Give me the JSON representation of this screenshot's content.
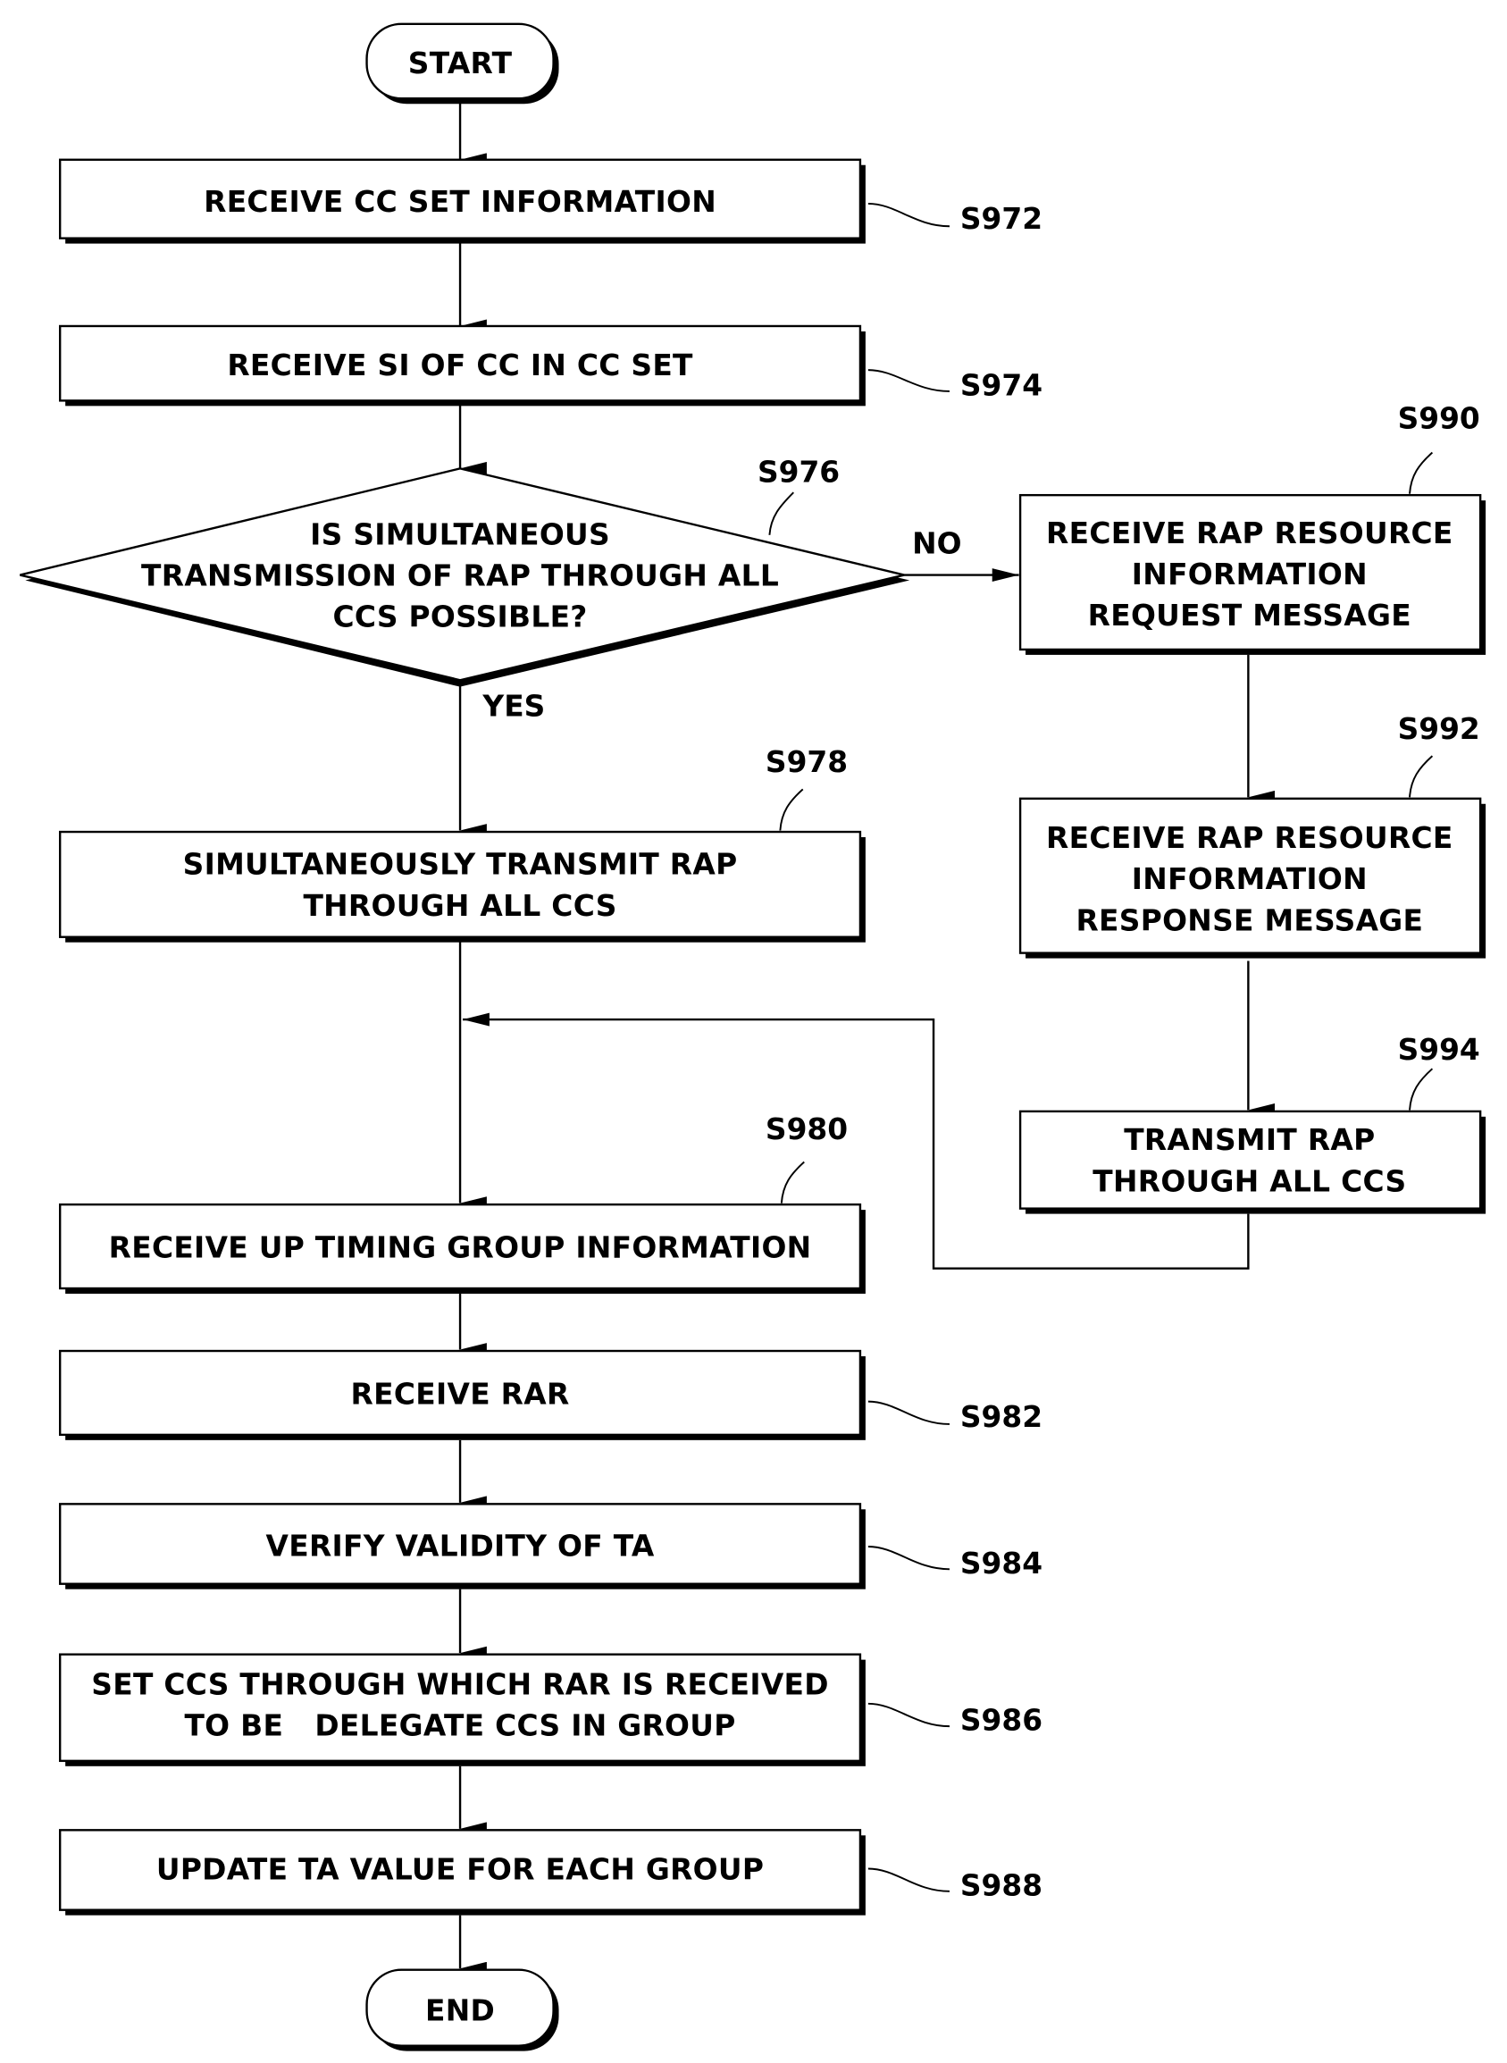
{
  "diagram": {
    "type": "flowchart",
    "nodes": {
      "start": {
        "id": "start",
        "kind": "terminal",
        "text": [
          "START"
        ]
      },
      "s972": {
        "id": "S972",
        "kind": "process",
        "text": [
          "RECEIVE CC SET INFORMATION"
        ],
        "label": "S972"
      },
      "s974": {
        "id": "S974",
        "kind": "process",
        "text": [
          "RECEIVE SI OF CC IN CC SET"
        ],
        "label": "S974"
      },
      "s976": {
        "id": "S976",
        "kind": "decision",
        "text": [
          "IS SIMULTANEOUS",
          "TRANSMISSION OF RAP THROUGH ALL",
          "CCS POSSIBLE?"
        ],
        "label": "S976"
      },
      "s978": {
        "id": "S978",
        "kind": "process",
        "text": [
          "SIMULTANEOUSLY TRANSMIT RAP",
          "THROUGH ALL CCS"
        ],
        "label": "S978"
      },
      "s980": {
        "id": "S980",
        "kind": "process",
        "text": [
          "RECEIVE UP TIMING GROUP INFORMATION"
        ],
        "label": "S980"
      },
      "s982": {
        "id": "S982",
        "kind": "process",
        "text": [
          "RECEIVE RAR"
        ],
        "label": "S982"
      },
      "s984": {
        "id": "S984",
        "kind": "process",
        "text": [
          "VERIFY VALIDITY OF TA"
        ],
        "label": "S984"
      },
      "s986": {
        "id": "S986",
        "kind": "process",
        "text": [
          "SET CCS THROUGH WHICH RAR IS RECEIVED",
          "TO BE   DELEGATE CCS IN GROUP"
        ],
        "label": "S986"
      },
      "s988": {
        "id": "S988",
        "kind": "process",
        "text": [
          "UPDATE TA VALUE FOR EACH GROUP"
        ],
        "label": "S988"
      },
      "s990": {
        "id": "S990",
        "kind": "process",
        "text": [
          "RECEIVE RAP RESOURCE",
          "INFORMATION",
          "REQUEST MESSAGE"
        ],
        "label": "S990"
      },
      "s992": {
        "id": "S992",
        "kind": "process",
        "text": [
          "RECEIVE RAP RESOURCE",
          "INFORMATION",
          "RESPONSE MESSAGE"
        ],
        "label": "S992"
      },
      "s994": {
        "id": "S994",
        "kind": "process",
        "text": [
          "TRANSMIT RAP",
          "THROUGH ALL CCS"
        ],
        "label": "S994"
      },
      "end": {
        "id": "end",
        "kind": "terminal",
        "text": [
          "END"
        ]
      }
    },
    "edges": [
      {
        "from": "start",
        "to": "s972",
        "label": ""
      },
      {
        "from": "s972",
        "to": "s974",
        "label": ""
      },
      {
        "from": "s974",
        "to": "s976",
        "label": ""
      },
      {
        "from": "s976",
        "to": "s978",
        "label": "YES"
      },
      {
        "from": "s976",
        "to": "s990",
        "label": "NO"
      },
      {
        "from": "s990",
        "to": "s992",
        "label": ""
      },
      {
        "from": "s992",
        "to": "s994",
        "label": ""
      },
      {
        "from": "s994",
        "to": "s980",
        "label": ""
      },
      {
        "from": "s978",
        "to": "s980",
        "label": ""
      },
      {
        "from": "s980",
        "to": "s982",
        "label": ""
      },
      {
        "from": "s982",
        "to": "s984",
        "label": ""
      },
      {
        "from": "s984",
        "to": "s986",
        "label": ""
      },
      {
        "from": "s986",
        "to": "s988",
        "label": ""
      },
      {
        "from": "s988",
        "to": "end",
        "label": ""
      }
    ],
    "edge_labels": {
      "yes": "YES",
      "no": "NO"
    }
  }
}
